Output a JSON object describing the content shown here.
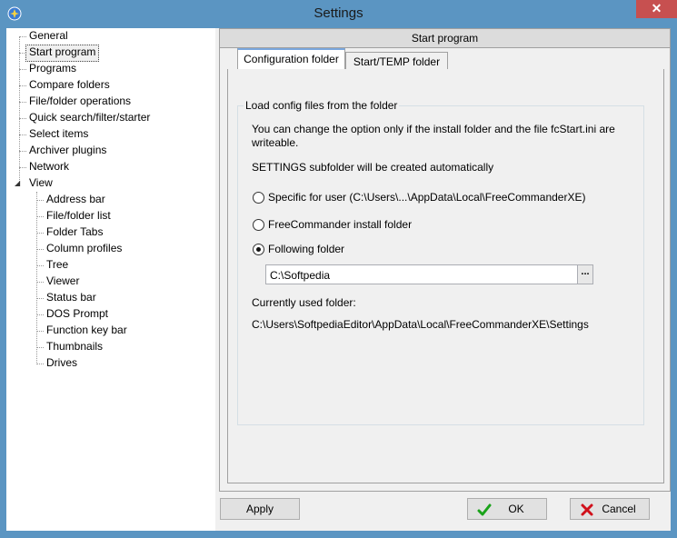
{
  "window": {
    "title": "Settings",
    "close_glyph": "✕",
    "app_icon": "app-globe-icon"
  },
  "sidebar": {
    "items": [
      {
        "label": "General",
        "level": 0
      },
      {
        "label": "Start program",
        "level": 0,
        "selected": true
      },
      {
        "label": "Programs",
        "level": 0
      },
      {
        "label": "Compare folders",
        "level": 0
      },
      {
        "label": "File/folder operations",
        "level": 0
      },
      {
        "label": "Quick search/filter/starter",
        "level": 0
      },
      {
        "label": "Select items",
        "level": 0
      },
      {
        "label": "Archiver plugins",
        "level": 0
      },
      {
        "label": "Network",
        "level": 0
      },
      {
        "label": "View",
        "level": 0,
        "expanded": true
      },
      {
        "label": "Address bar",
        "level": 1
      },
      {
        "label": "File/folder list",
        "level": 1
      },
      {
        "label": "Folder Tabs",
        "level": 1
      },
      {
        "label": "Column profiles",
        "level": 1
      },
      {
        "label": "Tree",
        "level": 1
      },
      {
        "label": "Viewer",
        "level": 1
      },
      {
        "label": "Status bar",
        "level": 1
      },
      {
        "label": "DOS Prompt",
        "level": 1
      },
      {
        "label": "Function key bar",
        "level": 1
      },
      {
        "label": "Thumbnails",
        "level": 1
      },
      {
        "label": "Drives",
        "level": 1
      }
    ],
    "expander_glyph": "◢"
  },
  "panel": {
    "header": "Start program",
    "tabs": [
      {
        "label": "Configuration folder",
        "active": true
      },
      {
        "label": "Start/TEMP folder",
        "active": false
      }
    ],
    "group": {
      "title": "Load config files from the folder",
      "info_line1": "You can change the option only if the install folder and the file fcStart.ini are",
      "info_line2": "writeable.",
      "auto_note": "SETTINGS subfolder will be created automatically",
      "options": [
        {
          "label": "Specific for user (C:\\Users\\...\\AppData\\Local\\FreeCommanderXE)",
          "checked": false
        },
        {
          "label": "FreeCommander install folder",
          "checked": false
        },
        {
          "label": "Following folder",
          "checked": true
        }
      ],
      "folder_value": "C:\\Softpedia",
      "browse_glyph": "...",
      "current_label": "Currently used folder:",
      "current_path": "C:\\Users\\SoftpediaEditor\\AppData\\Local\\FreeCommanderXE\\Settings"
    }
  },
  "footer": {
    "apply": "Apply",
    "ok": "OK",
    "cancel": "Cancel"
  },
  "colors": {
    "frame": "#5b95c2",
    "close": "#c75050",
    "ok_check": "#1aa31a",
    "cancel_x": "#d0101b"
  }
}
